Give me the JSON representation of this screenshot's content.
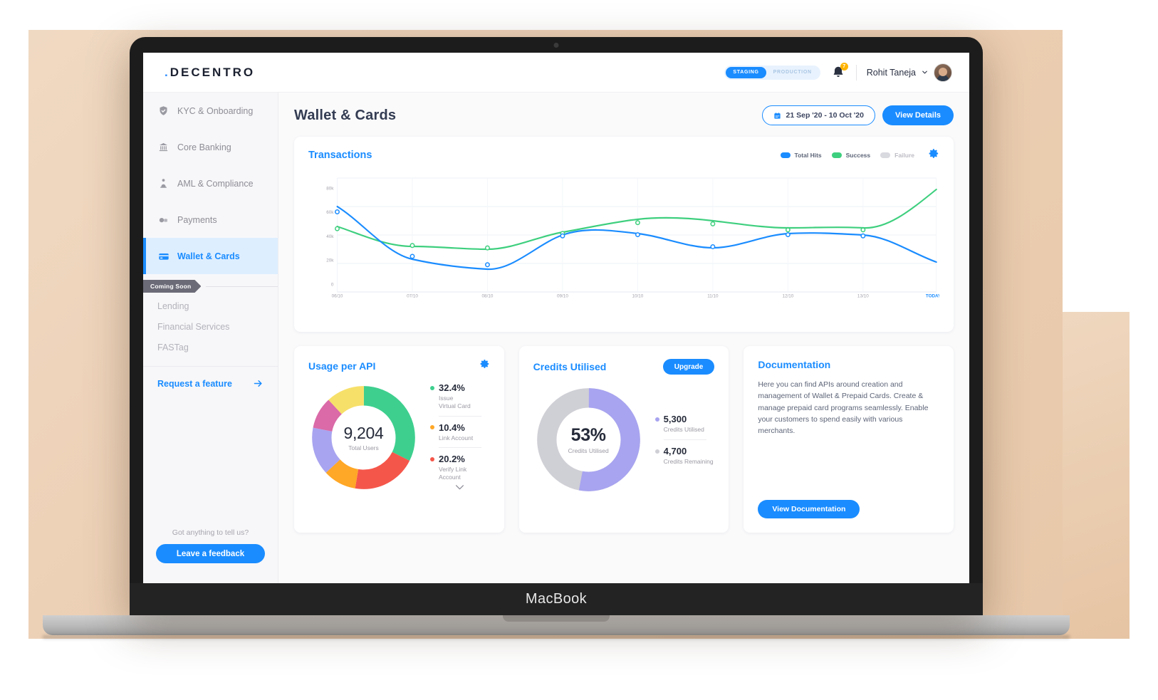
{
  "device": {
    "label": "MacBook"
  },
  "topbar": {
    "logo": "DECENTRO",
    "env": {
      "staging": "STAGING",
      "production": "PRODUCTION",
      "active": "STAGING"
    },
    "notifications": {
      "count": "7",
      "icon": "bell-icon"
    },
    "user": {
      "name": "Rohit Taneja",
      "chevron": "chevron-down-icon"
    }
  },
  "sidebar": {
    "items": [
      {
        "label": "KYC & Onboarding",
        "icon": "shield-icon",
        "active": false
      },
      {
        "label": "Core Banking",
        "icon": "bank-icon",
        "active": false
      },
      {
        "label": "AML & Compliance",
        "icon": "person-badge-icon",
        "active": false
      },
      {
        "label": "Payments",
        "icon": "payments-icon",
        "active": false
      },
      {
        "label": "Wallet & Cards",
        "icon": "card-icon",
        "active": true
      }
    ],
    "coming_soon": {
      "tag": "Coming Soon",
      "items": [
        "Lending",
        "Financial Services",
        "FASTag"
      ]
    },
    "request_feature": {
      "label": "Request a feature",
      "icon": "arrow-right-icon"
    },
    "feedback": {
      "question": "Got anything to tell us?",
      "button": "Leave a feedback"
    }
  },
  "page": {
    "title": "Wallet & Cards",
    "date_range": "21 Sep '20 - 10 Oct '20",
    "date_icon": "calendar-icon",
    "view_details": "View Details"
  },
  "transactions": {
    "title": "Transactions",
    "settings_icon": "gear-icon",
    "legend": [
      {
        "label": "Total Hits",
        "color": "#1a8cff"
      },
      {
        "label": "Success",
        "color": "#3ecf7e"
      },
      {
        "label": "Failure",
        "color": "#d9d9e0"
      }
    ]
  },
  "chart_data": {
    "type": "line",
    "title": "Transactions",
    "xlabel": "",
    "ylabel": "",
    "x": [
      "06/10",
      "07/10",
      "08/10",
      "09/10",
      "10/10",
      "11/10",
      "12/10",
      "13/10",
      "TODAY"
    ],
    "ytick_labels": [
      "0",
      "20k",
      "40k",
      "60k",
      "80k"
    ],
    "yticks": [
      0,
      20000,
      40000,
      60000,
      80000
    ],
    "ylim": [
      0,
      80000
    ],
    "grid": true,
    "legend_position": "top-right",
    "series": [
      {
        "name": "Total Hits",
        "color": "#1a8cff",
        "values": [
          60000,
          27000,
          21000,
          45000,
          47000,
          36000,
          46000,
          45000,
          28000
        ]
      },
      {
        "name": "Success",
        "color": "#3ecf7e",
        "values": [
          46000,
          32000,
          30000,
          42000,
          51000,
          53000,
          45000,
          45000,
          72000
        ]
      },
      {
        "name": "Failure",
        "color": "#d9d9e0",
        "values": []
      }
    ]
  },
  "usage": {
    "title": "Usage per API",
    "settings_icon": "gear-icon",
    "center_value": "9,204",
    "center_label": "Total Users",
    "expand_icon": "chevron-down-icon",
    "legend": [
      {
        "value": "32.4%",
        "label": "Issue\nVirtual Card",
        "color": "#3ecf8e"
      },
      {
        "value": "10.4%",
        "label": "Link Account",
        "color": "#ffa726"
      },
      {
        "value": "20.2%",
        "label": "Verify Link\nAccount",
        "color": "#f5564a"
      }
    ],
    "donut_chart": {
      "type": "pie",
      "values": [
        32.4,
        20.2,
        10.4,
        15.0,
        10.0,
        12.0
      ],
      "colors": [
        "#3ecf8e",
        "#f5564a",
        "#ffa726",
        "#a8a4f0",
        "#da6aa8",
        "#f7e06a"
      ]
    }
  },
  "credits": {
    "title": "Credits Utilised",
    "upgrade": "Upgrade",
    "center_value": "53%",
    "center_label": "Credits Utilised",
    "legend": [
      {
        "value": "5,300",
        "label": "Credits Utilised",
        "color": "#a8a4f0"
      },
      {
        "value": "4,700",
        "label": "Credits Remaining",
        "color": "#cfcfd6"
      }
    ],
    "donut_chart": {
      "type": "pie",
      "values": [
        53,
        47
      ],
      "colors": [
        "#a8a4f0",
        "#cfcfd6"
      ]
    }
  },
  "documentation": {
    "title": "Documentation",
    "body": "Here you can find APIs around creation and management of Wallet & Prepaid Cards. Create & manage prepaid card programs seamlessly. Enable your customers to spend easily with various merchants.",
    "button": "View Documentation"
  }
}
